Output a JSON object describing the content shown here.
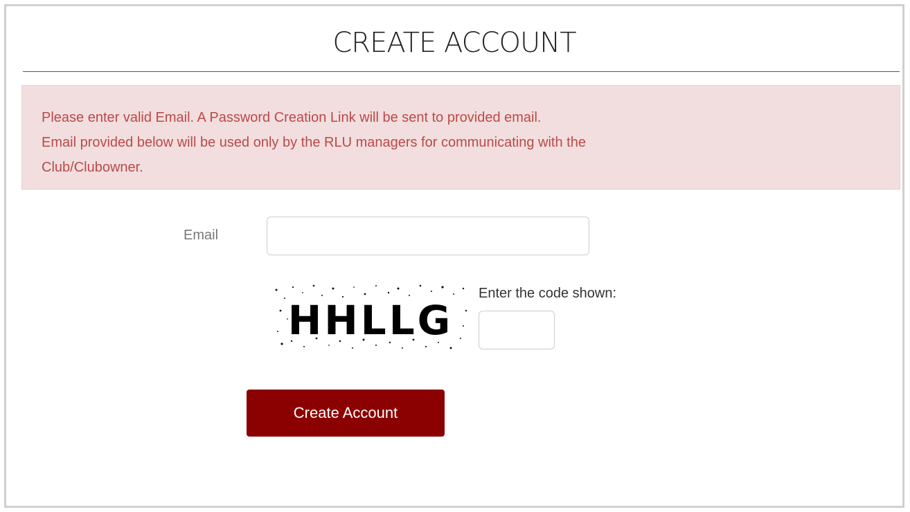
{
  "page": {
    "title": "CREATE ACCOUNT"
  },
  "alert": {
    "lines": [
      "Please enter valid Email. A Password Creation Link will be sent to provided email.",
      "Email provided below will be used only by the RLU managers for communicating with the",
      "Club/Clubowner."
    ]
  },
  "form": {
    "email_label": "Email",
    "email_value": "",
    "captcha_text": "HHLLG",
    "code_label": "Enter the code shown:",
    "code_value": "",
    "submit_label": "Create Account"
  },
  "colors": {
    "alert_bg": "#f2dede",
    "alert_text": "#b94a48",
    "button_bg": "#8b0000",
    "button_text": "#ffffff"
  }
}
